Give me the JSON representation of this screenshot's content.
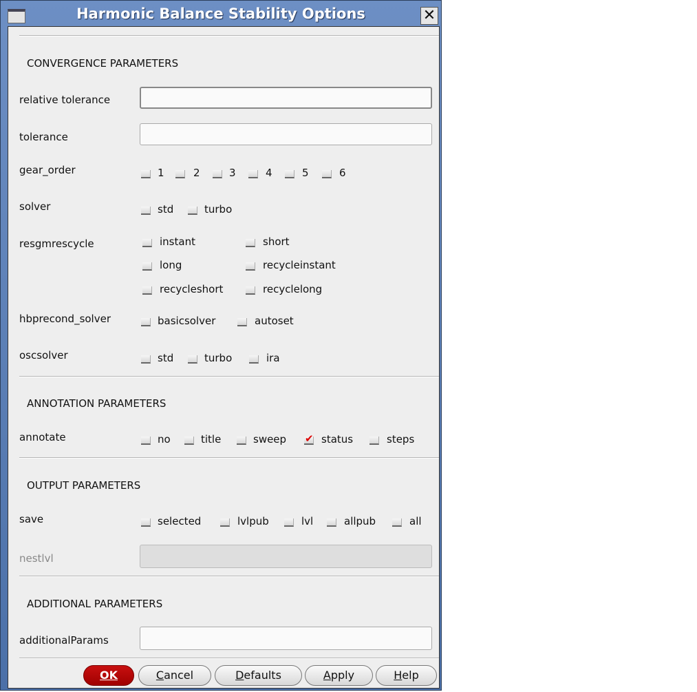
{
  "window": {
    "title": "Harmonic Balance Stability Options"
  },
  "sections": {
    "convergence": "CONVERGENCE PARAMETERS",
    "annotation": "ANNOTATION PARAMETERS",
    "output": "OUTPUT PARAMETERS",
    "additional": "ADDITIONAL PARAMETERS"
  },
  "fields": {
    "relative_tolerance": {
      "label": "relative tolerance",
      "value": ""
    },
    "tolerance": {
      "label": "tolerance",
      "value": ""
    },
    "nestlvl": {
      "label": "nestlvl",
      "value": ""
    },
    "additionalParams": {
      "label": "additionalParams",
      "value": ""
    }
  },
  "gear_order": {
    "label": "gear_order",
    "options": [
      "1",
      "2",
      "3",
      "4",
      "5",
      "6"
    ]
  },
  "solver": {
    "label": "solver",
    "options": [
      "std",
      "turbo"
    ]
  },
  "resgmrescycle": {
    "label": "resgmrescycle",
    "options": [
      "instant",
      "short",
      "long",
      "recycleinstant",
      "recycleshort",
      "recyclelong"
    ]
  },
  "hbprecond_solver": {
    "label": "hbprecond_solver",
    "options": [
      "basicsolver",
      "autoset"
    ]
  },
  "oscsolver": {
    "label": "oscsolver",
    "options": [
      "std",
      "turbo",
      "ira"
    ]
  },
  "annotate": {
    "label": "annotate",
    "options": [
      "no",
      "title",
      "sweep",
      "status",
      "steps"
    ],
    "checked": [
      "status"
    ]
  },
  "save": {
    "label": "save",
    "options": [
      "selected",
      "lvlpub",
      "lvl",
      "allpub",
      "all"
    ]
  },
  "buttons": {
    "ok": "OK",
    "cancel_u": "C",
    "cancel": "ancel",
    "defaults_u": "D",
    "defaults": "efaults",
    "apply_u": "A",
    "apply": "pply",
    "help_u": "H",
    "help": "elp"
  }
}
